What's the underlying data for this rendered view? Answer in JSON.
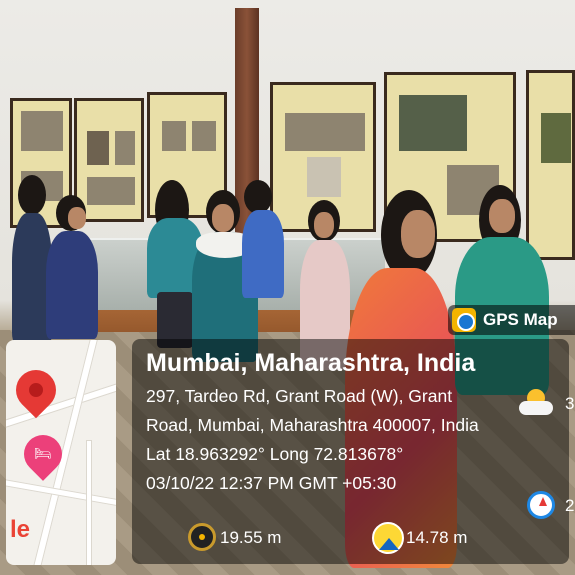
{
  "badge": {
    "label": "GPS Map"
  },
  "location": {
    "title": "Mumbai, Maharashtra, India",
    "address_line1": "297, Tardeo Rd, Grant Road (W), Grant",
    "address_line2": "Road, Mumbai, Maharashtra 400007, India",
    "coordinates": "Lat 18.963292° Long 72.813678°",
    "datetime": "03/10/22 12:37 PM GMT +05:30"
  },
  "metrics": {
    "accuracy": "19.55 m",
    "altitude": "14.78 m",
    "weather_partial": "3",
    "compass_partial": "2"
  },
  "map": {
    "logo_partial": "le"
  },
  "colors": {
    "pin": "#e53935",
    "hotel": "#ec407a",
    "badge_logo": "#f4b400"
  }
}
